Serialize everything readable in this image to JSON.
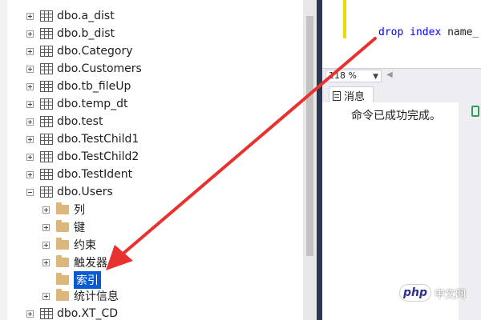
{
  "tree": {
    "items": [
      {
        "label": "dbo.a_dist",
        "type": "table",
        "expanded": false
      },
      {
        "label": "dbo.b_dist",
        "type": "table",
        "expanded": false
      },
      {
        "label": "dbo.Category",
        "type": "table",
        "expanded": false
      },
      {
        "label": "dbo.Customers",
        "type": "table",
        "expanded": false
      },
      {
        "label": "dbo.tb_fileUp",
        "type": "table",
        "expanded": false
      },
      {
        "label": "dbo.temp_dt",
        "type": "table",
        "expanded": false
      },
      {
        "label": "dbo.test",
        "type": "table",
        "expanded": false
      },
      {
        "label": "dbo.TestChild1",
        "type": "table",
        "expanded": false
      },
      {
        "label": "dbo.TestChild2",
        "type": "table",
        "expanded": false
      },
      {
        "label": "dbo.TestIdent",
        "type": "table",
        "expanded": false
      },
      {
        "label": "dbo.Users",
        "type": "table",
        "expanded": true
      },
      {
        "label": "列",
        "type": "folder",
        "expanded": false
      },
      {
        "label": "键",
        "type": "folder",
        "expanded": false
      },
      {
        "label": "约束",
        "type": "folder",
        "expanded": false
      },
      {
        "label": "触发器",
        "type": "folder",
        "expanded": false
      },
      {
        "label": "索引",
        "type": "folder",
        "selected": true
      },
      {
        "label": "统计信息",
        "type": "folder",
        "expanded": false
      },
      {
        "label": "dbo.XT_CD",
        "type": "table",
        "expanded": false
      }
    ]
  },
  "editor": {
    "code_keyword": "drop index",
    "code_rest": " name_"
  },
  "zoom": {
    "value": "118 %"
  },
  "results": {
    "tab_label": "消息",
    "message": "命令已成功完成。"
  },
  "watermark": {
    "badge": "php",
    "text": "中文网"
  },
  "colors": {
    "selection": "#0a5ad1",
    "arrow": "#e8322f",
    "divider": "#293955",
    "folder": "#dcb67a"
  }
}
